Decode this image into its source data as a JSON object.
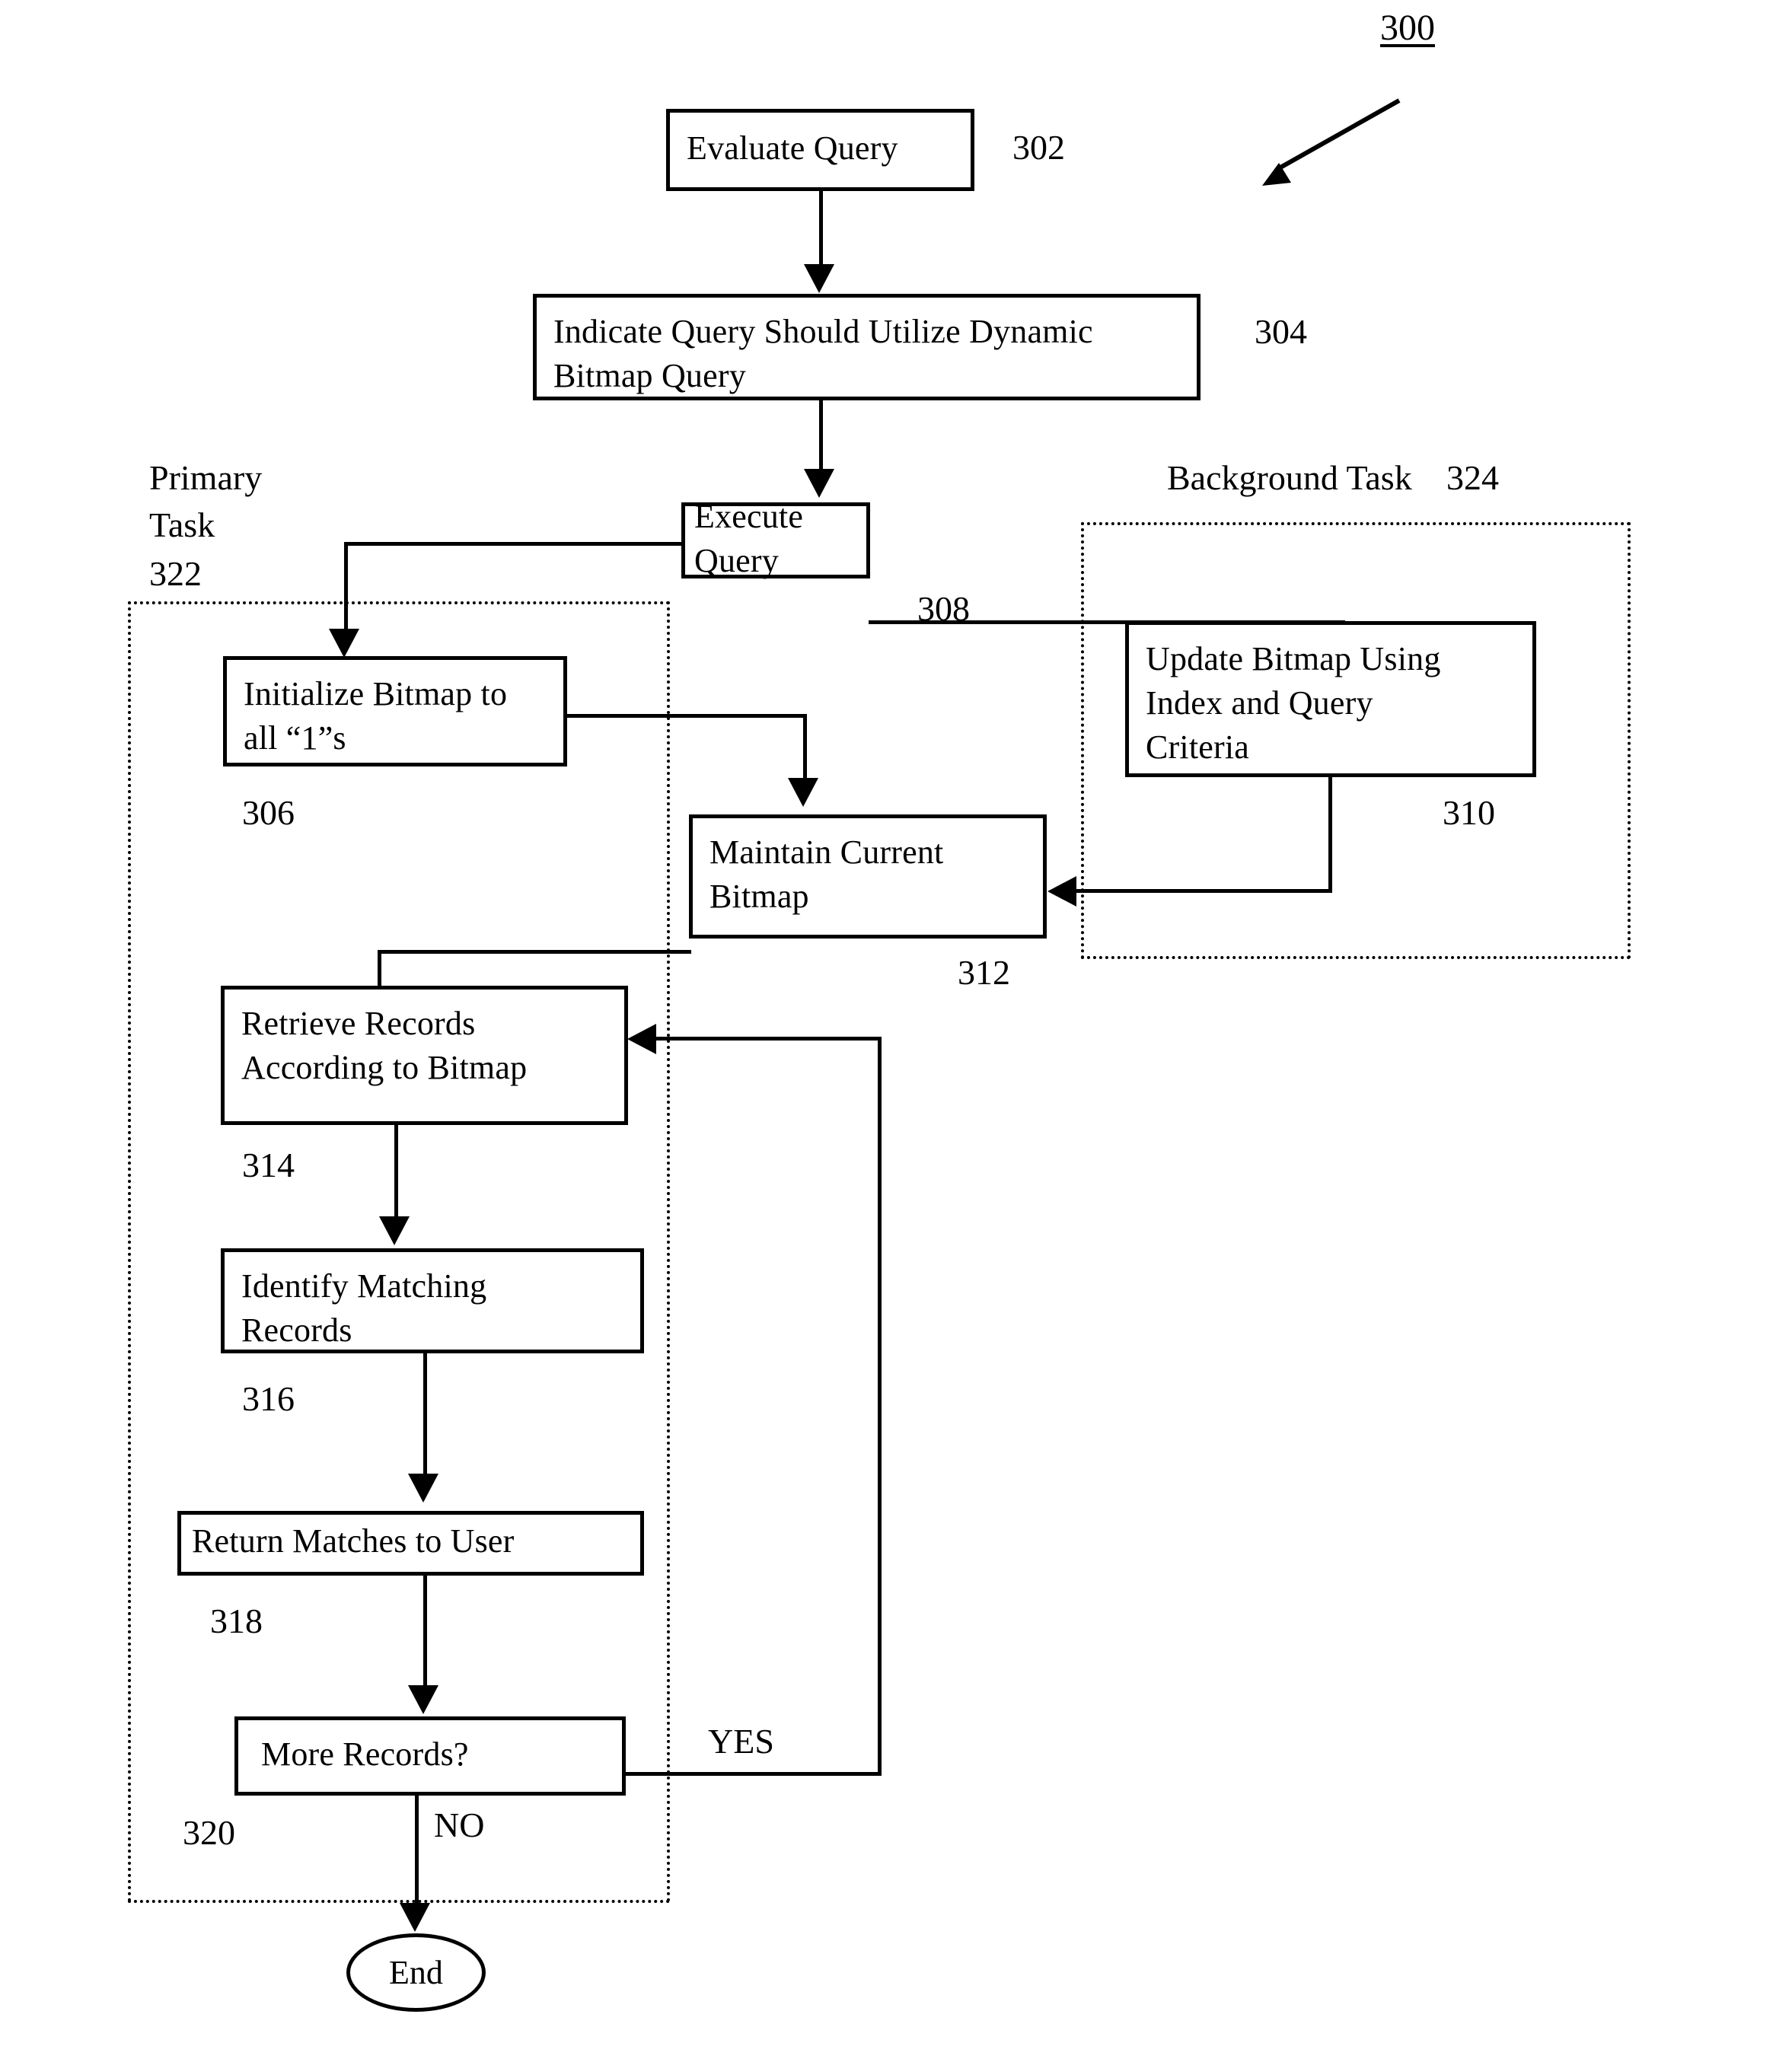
{
  "figure": {
    "number": "300",
    "pointer_icon": "diagonal-arrow-icon"
  },
  "regions": [
    {
      "id": "primary",
      "label_line1": "Primary",
      "label_line2": "Task",
      "numeral": "322"
    },
    {
      "id": "background",
      "label": "Background Task",
      "numeral": "324"
    }
  ],
  "nodes": [
    {
      "id": "n302",
      "text": "Evaluate Query",
      "numeral": "302",
      "shape": "rect"
    },
    {
      "id": "n304",
      "text": "Indicate Query Should Utilize Dynamic\nBitmap Query",
      "numeral": "304",
      "shape": "rect"
    },
    {
      "id": "n308",
      "text": "Execute Query",
      "numeral": "308",
      "shape": "rect"
    },
    {
      "id": "n306",
      "text": "Initialize Bitmap to\nall “1”s",
      "numeral": "306",
      "shape": "rect"
    },
    {
      "id": "n310",
      "text": "Update Bitmap Using\nIndex and Query\nCriteria",
      "numeral": "310",
      "shape": "rect"
    },
    {
      "id": "n312",
      "text": "Maintain Current\nBitmap",
      "numeral": "312",
      "shape": "rect"
    },
    {
      "id": "n314",
      "text": "Retrieve Records\nAccording to Bitmap",
      "numeral": "314",
      "shape": "rect"
    },
    {
      "id": "n316",
      "text": "Identify Matching\nRecords",
      "numeral": "316",
      "shape": "rect"
    },
    {
      "id": "n318",
      "text": "Return Matches to User",
      "numeral": "318",
      "shape": "rect"
    },
    {
      "id": "n320",
      "text": "More Records?",
      "numeral": "320",
      "shape": "rect"
    },
    {
      "id": "nend",
      "text": "End",
      "numeral": "",
      "shape": "oval"
    }
  ],
  "edge_labels": {
    "yes": "YES",
    "no": "NO"
  },
  "colors": {
    "ink": "#000000",
    "paper": "#ffffff"
  }
}
